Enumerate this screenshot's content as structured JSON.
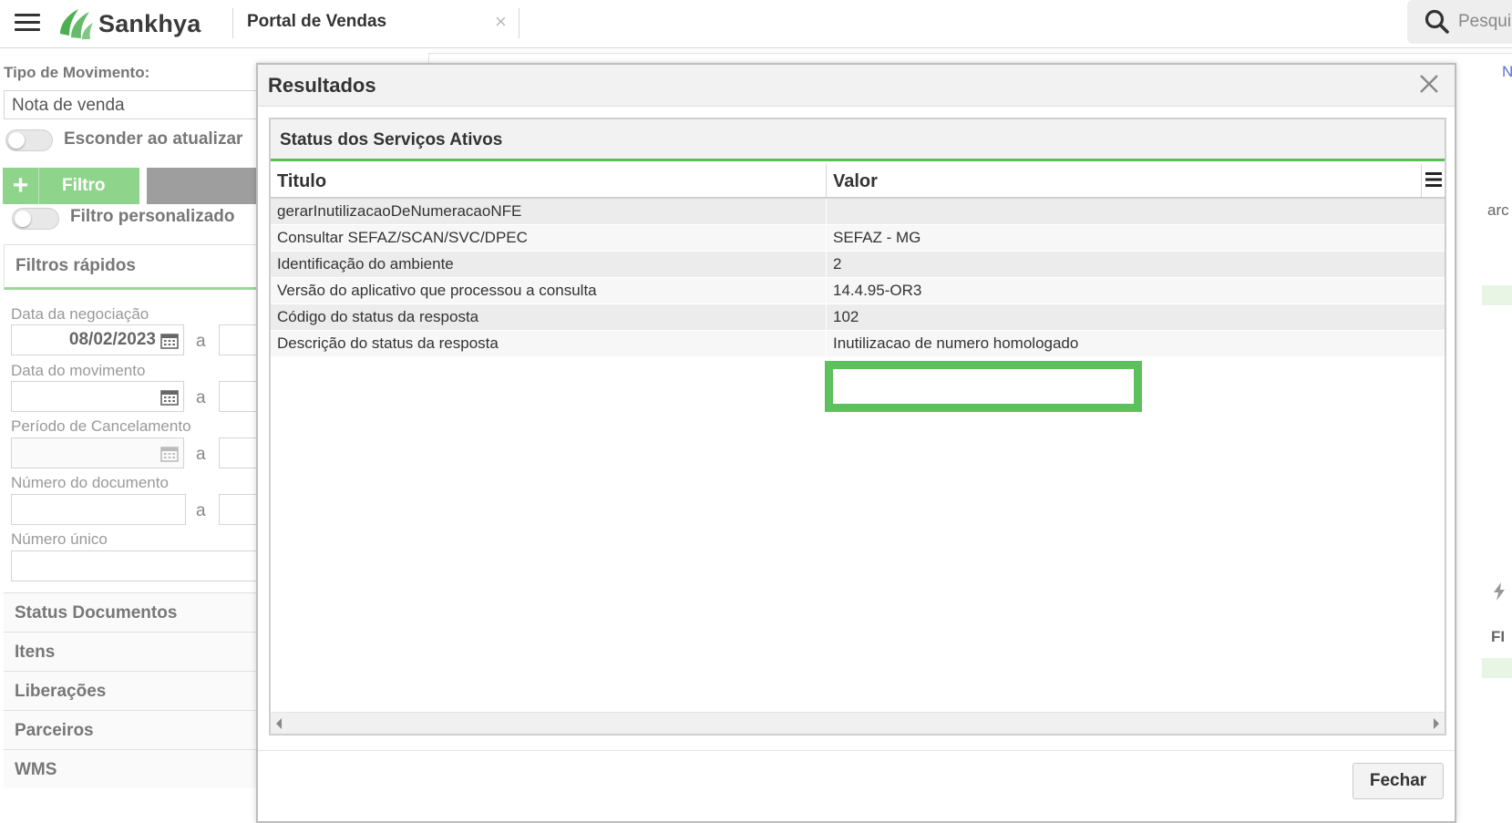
{
  "topbar": {
    "brand": "Sankhya",
    "tab_title": "Portal de Vendas",
    "tab_close": "×",
    "search_placeholder": "Pesqui"
  },
  "left_panel": {
    "tipo_label": "Tipo de Movimento:",
    "tipo_value": "Nota de venda",
    "esconder_label": "Esconder ao atualizar",
    "filtro_button": "Filtro",
    "filtro_plus": "+",
    "filtro_personalizado_label": "Filtro personalizado",
    "filtros_rapidos_title": "Filtros rápidos",
    "fields": {
      "data_negociacao_label": "Data da negociação",
      "data_negociacao_value": "08/02/2023",
      "data_movimento_label": "Data do movimento",
      "periodo_cancelamento_label": "Período de Cancelamento",
      "numero_documento_label": "Número do documento",
      "numero_unico_label": "Número único",
      "range_separator": "a"
    },
    "accordion": [
      "Status Documentos",
      "Itens",
      "Liberações",
      "Parceiros",
      "WMS"
    ]
  },
  "background": {
    "fragment_n": "N",
    "fragment_arc": "arc",
    "fragment_fi": "FI"
  },
  "modal": {
    "title": "Resultados",
    "panel_title": "Status dos Serviços Ativos",
    "columns": [
      "Titulo",
      "Valor"
    ],
    "rows": [
      {
        "titulo": "gerarInutilizacaoDeNumeracaoNFE",
        "valor": ""
      },
      {
        "titulo": "Consultar SEFAZ/SCAN/SVC/DPEC",
        "valor": "SEFAZ - MG"
      },
      {
        "titulo": "Identificação do ambiente",
        "valor": "2"
      },
      {
        "titulo": "Versão do aplicativo que processou a consulta",
        "valor": "14.4.95-OR3"
      },
      {
        "titulo": "Código do status da resposta",
        "valor": "102"
      },
      {
        "titulo": "Descrição do status da resposta",
        "valor": "Inutilizacao de numero homologado"
      }
    ],
    "close_button": "Fechar",
    "colors": {
      "accent_green": "#5cc05c",
      "filter_green": "#8ed48a"
    }
  }
}
